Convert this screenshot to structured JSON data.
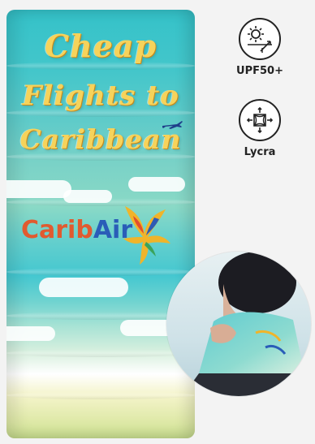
{
  "product": {
    "slogan_line1": "Cheap",
    "slogan_line2": "Flights to",
    "slogan_line3": "Caribbean",
    "brand_part1": "Carib",
    "brand_part2": "Air"
  },
  "features": [
    {
      "label": "UPF50+",
      "icon": "sun-protection-icon"
    },
    {
      "label": "Lycra",
      "icon": "stretch-fabric-icon"
    }
  ],
  "colors": {
    "tube_top": "#35c2c9",
    "slogan": "#f6d35b",
    "brand_orange": "#e15a2f",
    "brand_blue": "#2a5db8"
  }
}
